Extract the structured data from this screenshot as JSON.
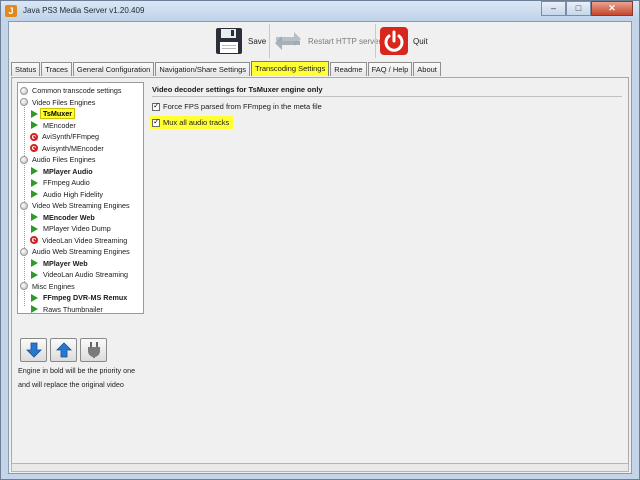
{
  "window": {
    "title": "Java PS3 Media Server v1.20.409",
    "controls": {
      "minimize": "–",
      "maximize": "□",
      "close": "✕"
    }
  },
  "toolbar": {
    "save_label": "Save",
    "restart_label": "Restart HTTP server",
    "quit_label": "Quit"
  },
  "tabs": [
    {
      "label": "Status"
    },
    {
      "label": "Traces"
    },
    {
      "label": "General Configuration"
    },
    {
      "label": "Navigation/Share Settings"
    },
    {
      "label": "Transcoding Settings",
      "active": true
    },
    {
      "label": "Readme"
    },
    {
      "label": "FAQ / Help"
    },
    {
      "label": "About"
    }
  ],
  "tree": {
    "items": [
      {
        "label": "Common transcode settings",
        "icon": "folder-icon"
      },
      {
        "label": "Video Files Engines",
        "icon": "folder-icon"
      },
      {
        "label": "TsMuxer",
        "icon": "play-icon",
        "bold": true,
        "selected": true
      },
      {
        "label": "MEncoder",
        "icon": "play-icon"
      },
      {
        "label": "AviSynth/FFmpeg",
        "icon": "disabled-icon"
      },
      {
        "label": "Avisynth/MEncoder",
        "icon": "disabled-icon"
      },
      {
        "label": "Audio Files Engines",
        "icon": "folder-icon"
      },
      {
        "label": "MPlayer Audio",
        "icon": "play-icon",
        "bold": true
      },
      {
        "label": "FFmpeg Audio",
        "icon": "play-icon"
      },
      {
        "label": "Audio High Fidelity",
        "icon": "play-icon"
      },
      {
        "label": "Video Web Streaming Engines",
        "icon": "folder-icon"
      },
      {
        "label": "MEncoder Web",
        "icon": "play-icon",
        "bold": true
      },
      {
        "label": "MPlayer Video Dump",
        "icon": "play-icon"
      },
      {
        "label": "VideoLan Video Streaming",
        "icon": "disabled-icon"
      },
      {
        "label": "Audio Web Streaming Engines",
        "icon": "folder-icon"
      },
      {
        "label": "MPlayer Web",
        "icon": "play-icon",
        "bold": true
      },
      {
        "label": "VideoLan Audio Streaming",
        "icon": "play-icon"
      },
      {
        "label": "Misc Engines",
        "icon": "folder-icon"
      },
      {
        "label": "FFmpeg DVR-MS Remux",
        "icon": "play-icon",
        "bold": true
      },
      {
        "label": "Raws Thumbnailer",
        "icon": "play-icon"
      }
    ]
  },
  "engine_buttons": {
    "up_icon": "arrow-down-icon",
    "down_icon": "arrow-up-icon",
    "toggle_icon": "plug-icon"
  },
  "notes": {
    "line1": "Engine in bold will be the priority one",
    "line2": "and will replace the original video"
  },
  "settings": {
    "title": "Video decoder settings for TsMuxer engine only",
    "force_fps_label": "Force FPS parsed from FFmpeg in the meta file",
    "force_fps_checked": true,
    "mux_audio_label": "Mux all audio tracks",
    "mux_audio_checked": true
  },
  "colors": {
    "highlight": "#ffff33",
    "window_frame": "#c4d5ea",
    "play_green": "#2f9a2a",
    "disabled_red": "#d42020"
  }
}
